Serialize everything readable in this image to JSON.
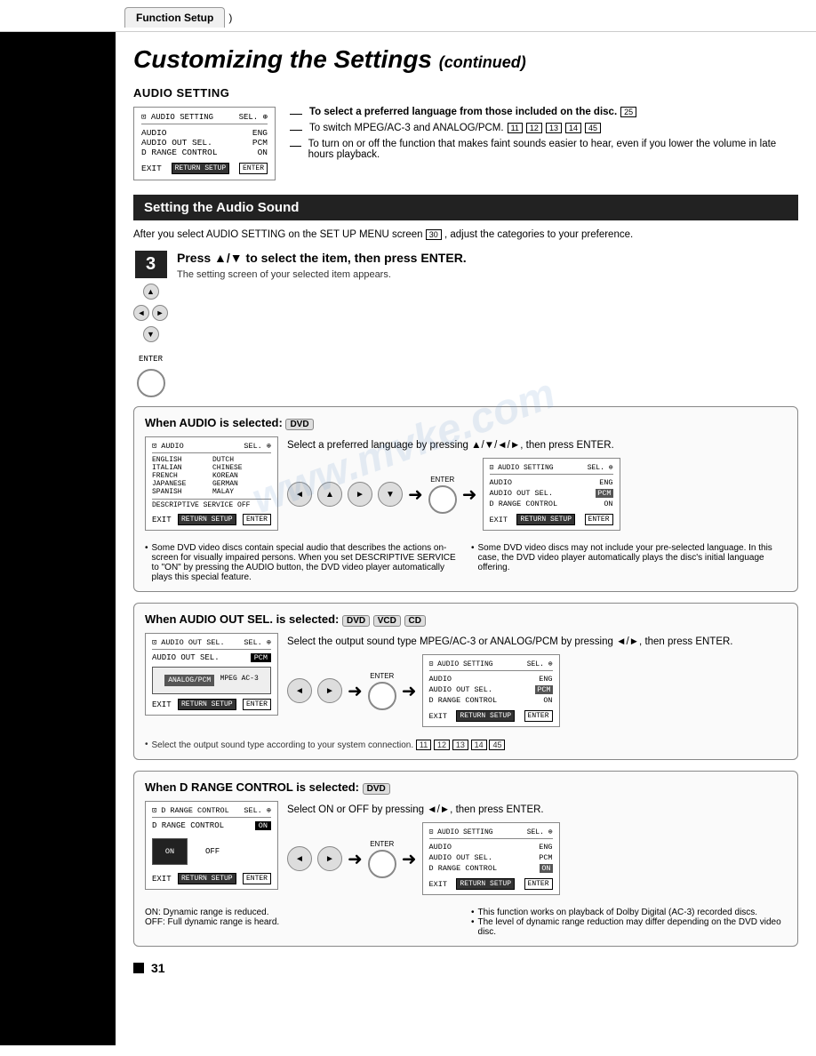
{
  "breadcrumb": {
    "label": "Function Setup",
    "arrow": ")"
  },
  "page_title": "Customizing the Settings",
  "page_title_suffix": "(continued)",
  "audio_setting": {
    "section_heading": "AUDIO SETTING",
    "screen": {
      "title_left": "⊡ AUDIO SETTING",
      "title_right": "SEL. ⊕",
      "row1_left": "AUDIO",
      "row1_right": "ENG",
      "row2_left": "AUDIO OUT SEL.",
      "row2_right": "PCM",
      "row3_left": "D RANGE CONTROL",
      "row3_right": "ON",
      "exit_left": "EXIT",
      "exit_btn": "RETURN SETUP",
      "exit_right": "ENTER"
    },
    "notes": [
      {
        "text": "To select a preferred language from those included on the disc.",
        "badge": "25"
      },
      {
        "text": "To switch MPEG/AC-3 and ANALOG/PCM.",
        "badges": [
          "11",
          "12",
          "13",
          "14",
          "45"
        ]
      },
      {
        "text": "To turn on or off the function that makes faint sounds easier to hear, even if you lower the volume in late hours playback."
      }
    ]
  },
  "dark_section": {
    "title": "Setting the Audio Sound"
  },
  "intro": {
    "text": "After you select AUDIO SETTING on the SET UP MENU screen",
    "badge": "30",
    "text2": ", adjust the categories to your preference."
  },
  "step3": {
    "number": "3",
    "instruction": "Press ▲/▼ to select the item, then press ENTER.",
    "sub": "The setting screen of your selected item appears."
  },
  "when_audio": {
    "title": "When AUDIO is selected:",
    "disc": "DVD",
    "screen": {
      "title_left": "⊡ AUDIO",
      "title_right": "SEL. ⊕",
      "languages": [
        "ENGLISH",
        "FRENCH",
        "SPANISH",
        "CHINESE",
        "GERMAN",
        "ITALIAN",
        "JAPANESE",
        "DUTCH",
        "KOREAN",
        "MALAY"
      ],
      "bottom_row1": "DESCRIPTIVE SERVICE OFF",
      "exit_btn": "RETURN SETUP",
      "exit_right": "ENTER"
    },
    "instruction": "Select a preferred language by pressing ▲/▼/◄/►, then press ENTER.",
    "result_screen": {
      "title_left": "⊡ AUDIO SETTING",
      "title_right": "SEL. ⊕",
      "row1_left": "AUDIO",
      "row1_right": "ENG",
      "row2_left": "AUDIO OUT SEL.",
      "row2_right": "PCM",
      "row3_left": "D RANGE CONTROL",
      "row3_right": "ON",
      "exit_btn": "RETURN SETUP",
      "exit_right": "ENTER"
    },
    "note1": "Some DVD video discs contain special audio that describes the actions on-screen for visually impaired persons. When you set DESCRIPTIVE SERVICE to \"ON\" by pressing the AUDIO button, the DVD video player automatically plays this special feature.",
    "note2": "Some DVD video discs may not include your pre-selected language. In this case, the DVD video player automatically plays the disc's initial language offering."
  },
  "when_audio_out": {
    "title": "When AUDIO OUT SEL. is selected:",
    "discs": [
      "DVD",
      "VCD",
      "CD"
    ],
    "screen": {
      "title_left": "⊡ AUDIO OUT SEL.",
      "title_right": "SEL. ⊕",
      "row1": "AUDIO OUT SEL.",
      "row1_val": "PCM",
      "option_left": "ANALOG/PCM",
      "option_right": "MPEG AC-3",
      "exit_btn": "RETURN SETUP",
      "exit_right": "ENTER"
    },
    "instruction": "Select the output sound type MPEG/AC-3 or ANALOG/PCM by pressing ◄/►, then press ENTER.",
    "result_screen": {
      "title_left": "⊡ AUDIO SETTING",
      "title_right": "SEL. ⊕",
      "row1_left": "AUDIO",
      "row1_right": "ENG",
      "row2_left": "AUDIO OUT SEL.",
      "row2_right": "PCM",
      "row3_left": "D RANGE CONTROL",
      "row3_right": "ON",
      "exit_btn": "RETURN SETUP",
      "exit_right": "ENTER"
    },
    "note": "Select the output sound type according to your system connection.",
    "note_badges": [
      "11",
      "12",
      "13",
      "14",
      "45"
    ]
  },
  "when_d_range": {
    "title": "When D RANGE CONTROL is selected:",
    "disc": "DVD",
    "screen": {
      "title_left": "⊡ D RANGE CONTROL",
      "title_right": "SEL. ⊕",
      "row1": "D RANGE CONTROL",
      "row1_val": "ON",
      "option_on": "ON",
      "option_off": "OFF",
      "exit_btn": "RETURN SETUP",
      "exit_right": "ENTER"
    },
    "instruction": "Select ON or OFF by pressing ◄/►, then press ENTER.",
    "result_screen": {
      "title_left": "⊡ AUDIO SETTING",
      "title_right": "SEL. ⊕",
      "row1_left": "AUDIO",
      "row1_right": "ENG",
      "row2_left": "AUDIO OUT SEL.",
      "row2_right": "PCM",
      "row3_left": "D RANGE CONTROL",
      "row3_right": "ON",
      "exit_btn": "RETURN SETUP",
      "exit_right": "ENTER"
    },
    "on_note": "ON:   Dynamic range is reduced.",
    "off_note": "OFF:  Full dynamic range is heard.",
    "note1": "This function works on playback of Dolby Digital (AC-3) recorded discs.",
    "note2": "The level of dynamic range reduction may differ depending on the DVD video disc."
  },
  "page_number": "31",
  "watermark": "www.mvke.com"
}
